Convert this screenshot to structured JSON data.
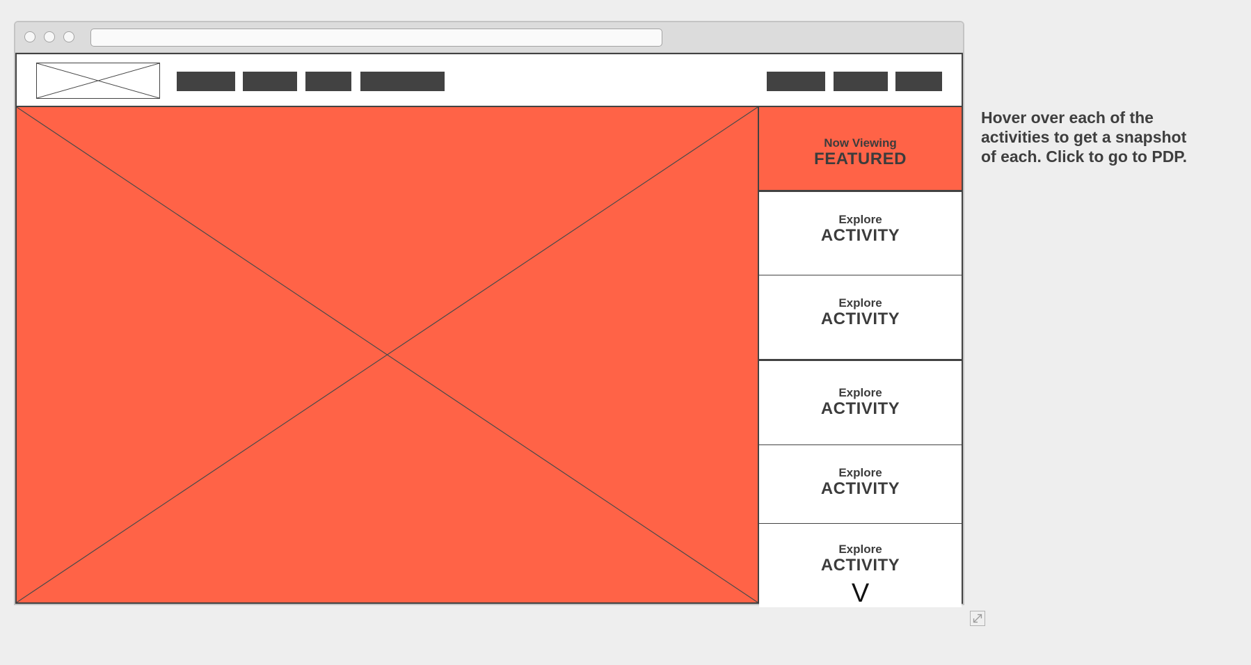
{
  "sidebar": {
    "featured": {
      "label": "Now Viewing",
      "title": "FEATURED"
    },
    "activities": [
      {
        "label": "Explore",
        "title": "ACTIVITY"
      },
      {
        "label": "Explore",
        "title": "ACTIVITY"
      },
      {
        "label": "Explore",
        "title": "ACTIVITY"
      },
      {
        "label": "Explore",
        "title": "ACTIVITY"
      },
      {
        "label": "Explore",
        "title": "ACTIVITY"
      }
    ],
    "more_glyph": "V"
  },
  "annotation": {
    "text": "Hover over each of the activities to get a snapshot of each. Click to go to PDP."
  },
  "colors": {
    "accent": "#ff6347",
    "dark": "#424242",
    "background": "#eeeeee"
  },
  "icons": {
    "logo_placeholder": "image-placeholder-icon",
    "expand": "expand-icon"
  }
}
